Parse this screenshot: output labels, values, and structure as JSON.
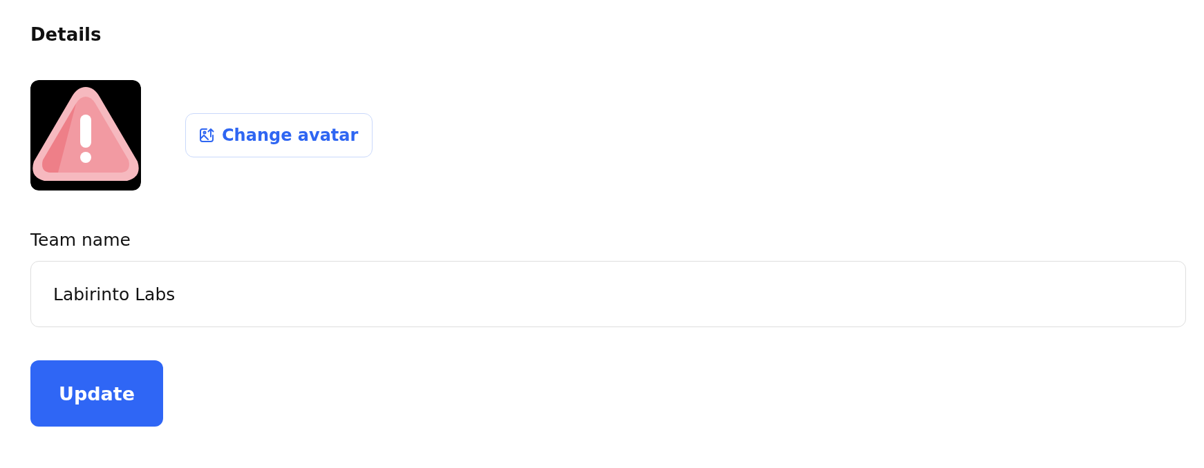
{
  "heading": "Details",
  "avatar_button": {
    "label": "Change avatar"
  },
  "team_name": {
    "label": "Team name",
    "value": "Labirinto Labs"
  },
  "submit_button": {
    "label": "Update"
  }
}
